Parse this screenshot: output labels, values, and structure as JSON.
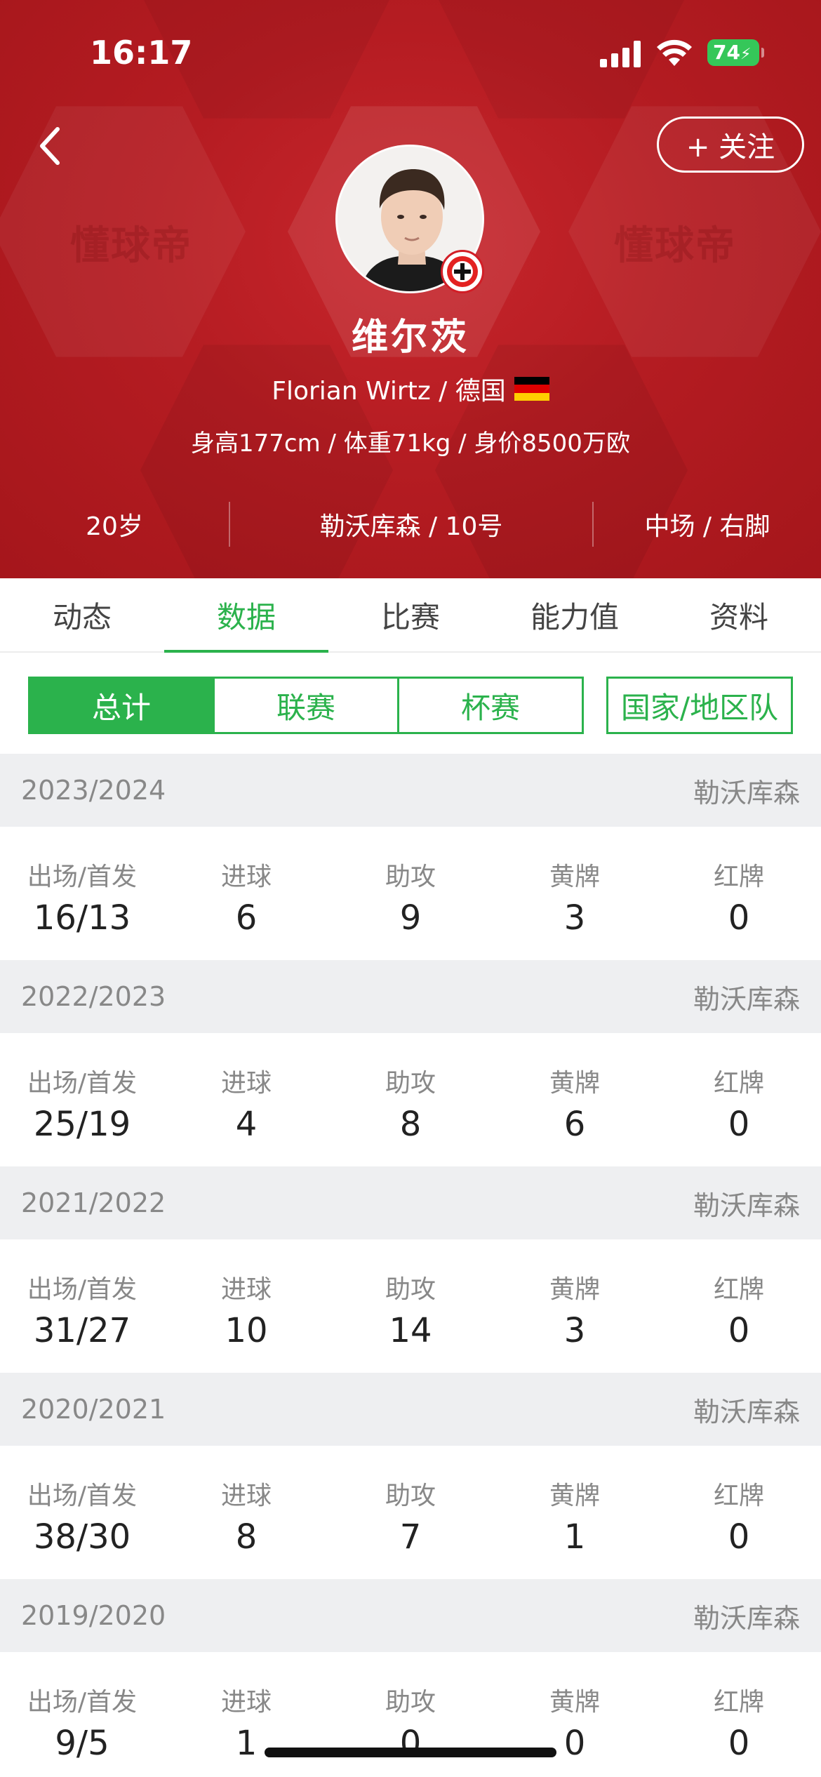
{
  "status_bar": {
    "time": "16:17",
    "battery": "74"
  },
  "header": {
    "watermark": "懂球帝",
    "follow_label": "+ 关注",
    "name": "维尔茨",
    "english_name_country": "Florian Wirtz / 德国",
    "body_info": "身高177cm / 体重71kg / 身价8500万欧",
    "age": "20岁",
    "club_number": "勒沃库森 / 10号",
    "position_foot": "中场 / 右脚"
  },
  "tabs": [
    "动态",
    "数据",
    "比赛",
    "能力值",
    "资料"
  ],
  "filters": {
    "total": "总计",
    "league": "联赛",
    "cup": "杯赛",
    "national": "国家/地区队"
  },
  "stat_labels": {
    "apps": "出场/首发",
    "goals": "进球",
    "assists": "助攻",
    "yellow": "黄牌",
    "red": "红牌"
  },
  "seasons": [
    {
      "season": "2023/2024",
      "club": "勒沃库森",
      "apps": "16/13",
      "goals": "6",
      "assists": "9",
      "yellow": "3",
      "red": "0"
    },
    {
      "season": "2022/2023",
      "club": "勒沃库森",
      "apps": "25/19",
      "goals": "4",
      "assists": "8",
      "yellow": "6",
      "red": "0"
    },
    {
      "season": "2021/2022",
      "club": "勒沃库森",
      "apps": "31/27",
      "goals": "10",
      "assists": "14",
      "yellow": "3",
      "red": "0"
    },
    {
      "season": "2020/2021",
      "club": "勒沃库森",
      "apps": "38/30",
      "goals": "8",
      "assists": "7",
      "yellow": "1",
      "red": "0"
    },
    {
      "season": "2019/2020",
      "club": "勒沃库森",
      "apps": "9/5",
      "goals": "1",
      "assists": "0",
      "yellow": "0",
      "red": "0"
    }
  ],
  "colors": {
    "header_red": "#b51c22",
    "accent_green": "#2bb24c",
    "battery_green": "#35c759"
  }
}
